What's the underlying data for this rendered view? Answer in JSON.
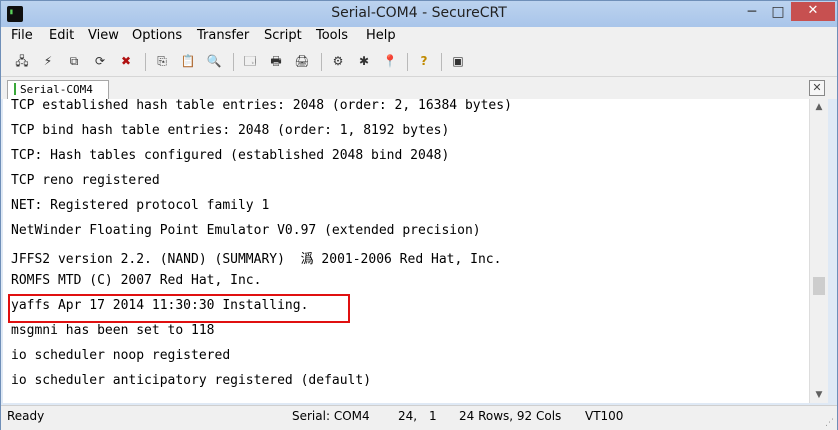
{
  "window": {
    "title": "Serial-COM4 - SecureCRT",
    "close_label": "✕",
    "minimize_label": "─",
    "maximize_label": "□"
  },
  "menu": [
    "File",
    "Edit",
    "View",
    "Options",
    "Transfer",
    "Script",
    "Tools",
    "Help"
  ],
  "toolbar": [
    {
      "name": "connect-icon",
      "glyph": "🖧"
    },
    {
      "name": "quick-connect-icon",
      "glyph": "⚡"
    },
    {
      "name": "connect-in-tab-icon",
      "glyph": "⧉"
    },
    {
      "name": "disconnect-icon",
      "glyph": "✖"
    },
    {
      "name": "copy-icon",
      "glyph": "⎘"
    },
    {
      "name": "paste-icon",
      "glyph": "📋"
    },
    {
      "name": "find-icon",
      "glyph": "🔍"
    },
    {
      "name": "session-options-icon",
      "glyph": "🗔"
    },
    {
      "name": "print-setup-icon",
      "glyph": "🖶"
    },
    {
      "name": "print-icon",
      "glyph": "🖨"
    },
    {
      "name": "global-options-icon",
      "glyph": "⚙"
    },
    {
      "name": "keymap-icon",
      "glyph": "✱"
    },
    {
      "name": "sftp-icon",
      "glyph": "📍"
    },
    {
      "name": "help-icon",
      "glyph": "?"
    },
    {
      "name": "screen-icon",
      "glyph": "▣"
    }
  ],
  "tab": {
    "label": "Serial-COM4",
    "close_label": "✕"
  },
  "terminal": {
    "lines": [
      "TCP established hash table entries: 2048 (order: 2, 16384 bytes)",
      "TCP bind hash table entries: 2048 (order: 1, 8192 bytes)",
      "TCP: Hash tables configured (established 2048 bind 2048)",
      "TCP reno registered",
      "NET: Registered protocol family 1",
      "NetWinder Floating Point Emulator V0.97 (extended precision)",
      "JFFS2 version 2.2. (NAND) (SUMMARY)  潙 2001-2006 Red Hat, Inc.",
      "ROMFS MTD (C) 2007 Red Hat, Inc.",
      "yaffs Apr 17 2014 11:30:30 Installing.",
      "msgmni has been set to 118",
      "io scheduler noop registered",
      "io scheduler anticipatory registered (default)"
    ]
  },
  "scrollbar": {
    "up_arrow": "▲",
    "down_arrow": "▼"
  },
  "status": {
    "state": "Ready",
    "port": "Serial: COM4",
    "row": "24,",
    "col": "1",
    "size": "24 Rows,  92 Cols",
    "emulation": "VT100"
  },
  "colors": {
    "highlight": "#e01010",
    "title_bar": "#a9c5ea",
    "close_button": "#c75050"
  }
}
